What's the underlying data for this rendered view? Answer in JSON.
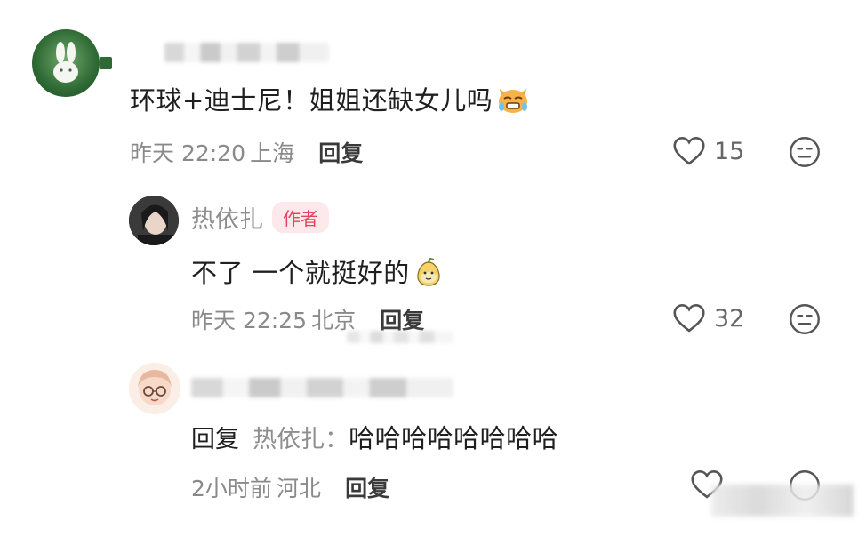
{
  "comments": [
    {
      "text": "环球+迪士尼！姐姐还缺女儿吗",
      "time": "昨天 22:20",
      "location": "上海",
      "reply_label": "回复",
      "likes": "15",
      "emoji_icon": "crying-cat-emoji"
    },
    {
      "nickname": "热依扎",
      "author_tag": "作者",
      "text": "不了 一个就挺好的",
      "time": "昨天 22:25",
      "location": "北京",
      "reply_label": "回复",
      "likes": "32",
      "emoji_icon": "pear-face-emoji"
    },
    {
      "reply_prefix": "回复",
      "reply_to": "热依扎：",
      "text": "哈哈哈哈哈哈哈哈",
      "time": "2小时前",
      "location": "河北",
      "reply_label": "回复"
    }
  ],
  "colors": {
    "author_tag": "#e0455f",
    "author_tag_bg": "#fde8ec",
    "text": "#1f1f1f",
    "meta": "#8a8a8a"
  }
}
